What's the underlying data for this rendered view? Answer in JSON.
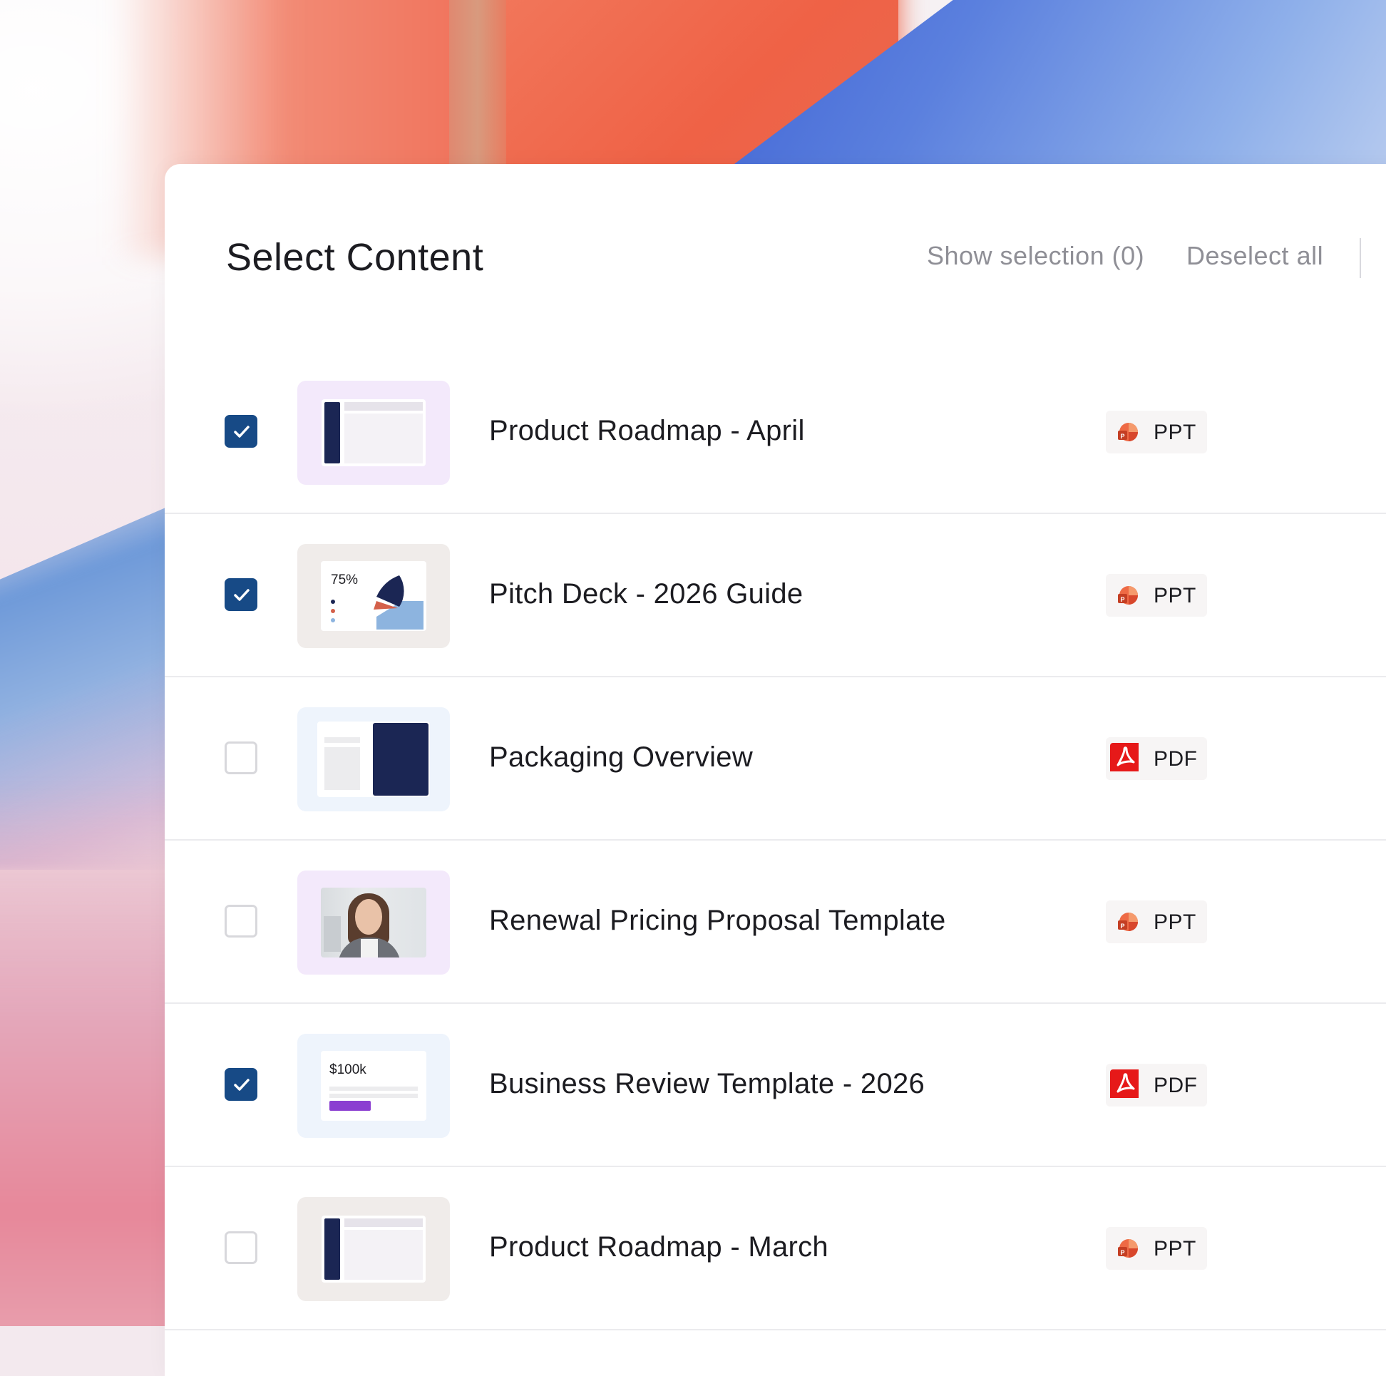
{
  "header": {
    "title": "Select Content",
    "show_selection_label": "Show selection (0)",
    "deselect_all_label": "Deselect all"
  },
  "items": [
    {
      "title": "Product Roadmap - April",
      "type": "PPT",
      "checked": true,
      "thumb_bg": "#f3e9fb",
      "thumb_style": "roadmap"
    },
    {
      "title": "Pitch Deck - 2026 Guide",
      "type": "PPT",
      "checked": true,
      "thumb_bg": "#f0ecea",
      "thumb_style": "pitch",
      "thumb_text": "75%"
    },
    {
      "title": "Packaging Overview",
      "type": "PDF",
      "checked": false,
      "thumb_bg": "#eef4fc",
      "thumb_style": "packaging"
    },
    {
      "title": "Renewal Pricing Proposal Template",
      "type": "PPT",
      "checked": false,
      "thumb_bg": "#f3e9fb",
      "thumb_style": "photo"
    },
    {
      "title": "Business Review Template - 2026",
      "type": "PDF",
      "checked": true,
      "thumb_bg": "#eef4fc",
      "thumb_style": "business",
      "thumb_text": "$100k"
    },
    {
      "title": "Product Roadmap - March",
      "type": "PPT",
      "checked": false,
      "thumb_bg": "#f0ecea",
      "thumb_style": "roadmap"
    }
  ],
  "colors": {
    "checkbox_checked": "#174a86",
    "navy": "#1b2654",
    "ppt_icon": "#e8502f",
    "pdf_icon": "#e61919"
  },
  "icons": {
    "check": "check-icon",
    "ppt": "powerpoint-icon",
    "pdf": "acrobat-pdf-icon"
  }
}
